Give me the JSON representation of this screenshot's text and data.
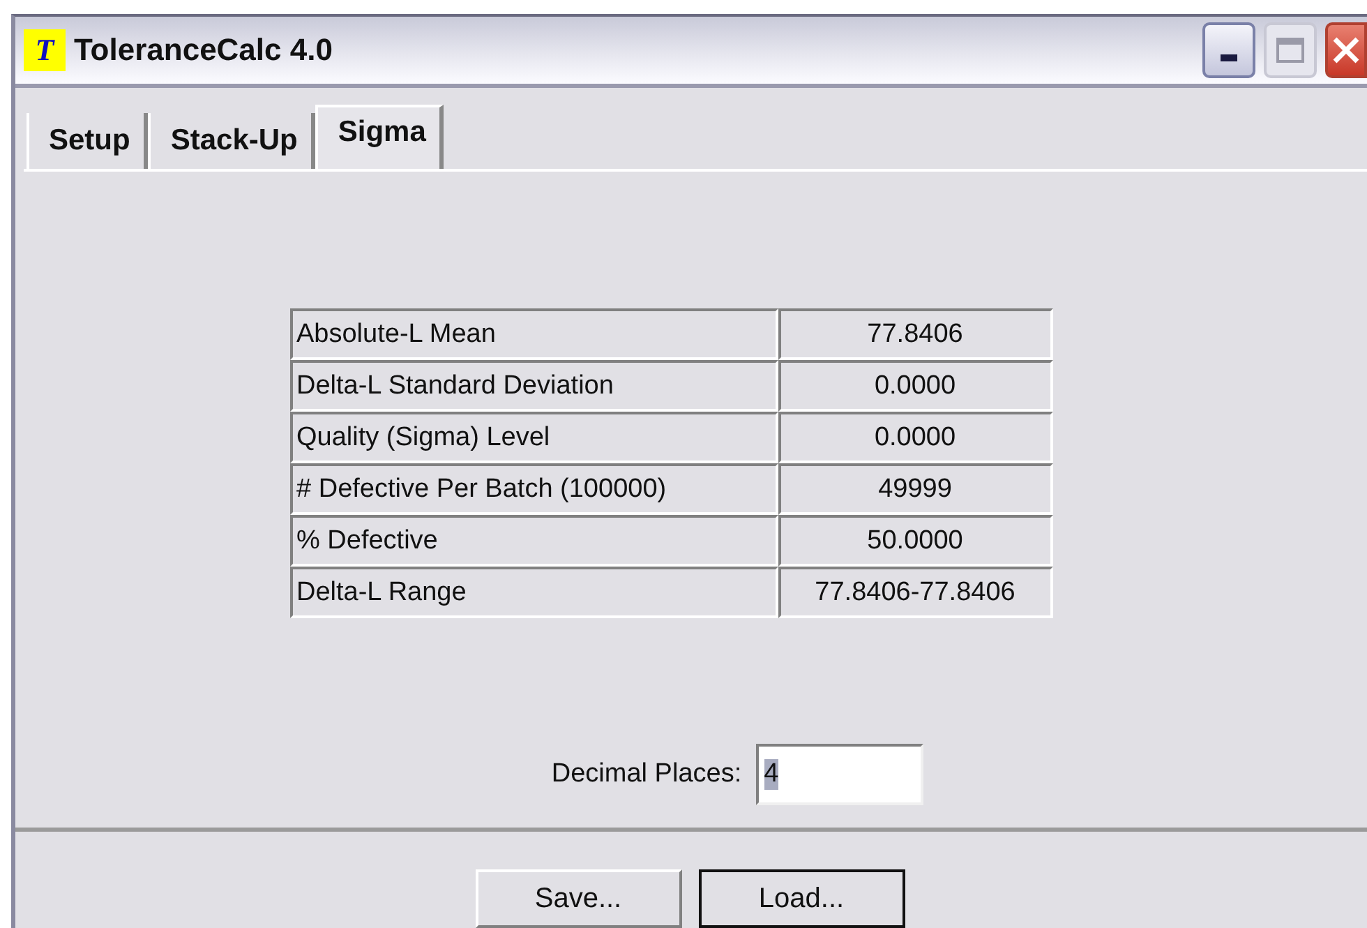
{
  "window": {
    "icon_letter": "T",
    "title": "ToleranceCalc 4.0"
  },
  "tabs": [
    {
      "label": "Setup",
      "selected": false
    },
    {
      "label": "Stack-Up",
      "selected": false
    },
    {
      "label": "Sigma",
      "selected": true
    }
  ],
  "results": [
    {
      "label": "Absolute-L Mean",
      "value": "77.8406"
    },
    {
      "label": "Delta-L Standard Deviation",
      "value": "0.0000"
    },
    {
      "label": "Quality (Sigma) Level",
      "value": "0.0000"
    },
    {
      "label": "# Defective Per Batch (100000)",
      "value": "49999"
    },
    {
      "label": "% Defective",
      "value": "50.0000"
    },
    {
      "label": "Delta-L Range",
      "value": "77.8406-77.8406"
    }
  ],
  "decimal_places": {
    "label": "Decimal Places:",
    "value": "4"
  },
  "buttons": [
    {
      "label": "Save...",
      "default": false
    },
    {
      "label": "Load...",
      "default": true
    }
  ]
}
